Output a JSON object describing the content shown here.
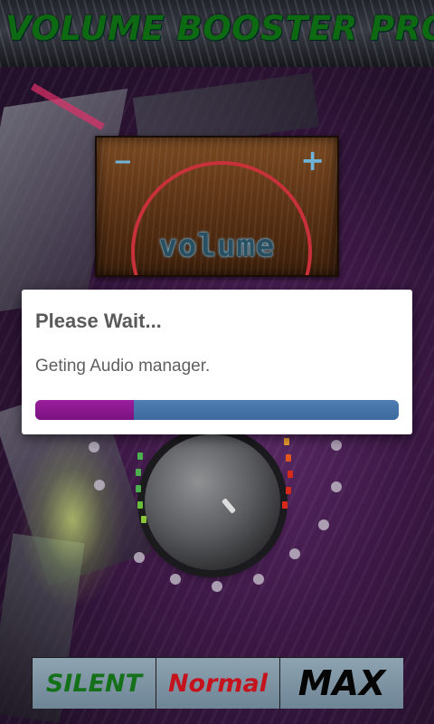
{
  "app": {
    "title": "VOLUME BOOSTER PRO"
  },
  "volume_panel": {
    "minus_symbol": "−",
    "plus_symbol": "+",
    "label": "volume"
  },
  "dialog": {
    "title": "Please Wait...",
    "message": "Geting Audio manager.",
    "progress_fraction": 0.27,
    "progress_color": "#8b1a8f",
    "track_color": "#4a78ad"
  },
  "modes": [
    {
      "label": "SILENT",
      "color": "#15701a"
    },
    {
      "label": "Normal",
      "color": "#c4131c"
    },
    {
      "label": "MAX",
      "color": "#050505"
    }
  ],
  "icons": {
    "knob": "volume-knob-icon",
    "level_dots": "level-dot-icon"
  }
}
